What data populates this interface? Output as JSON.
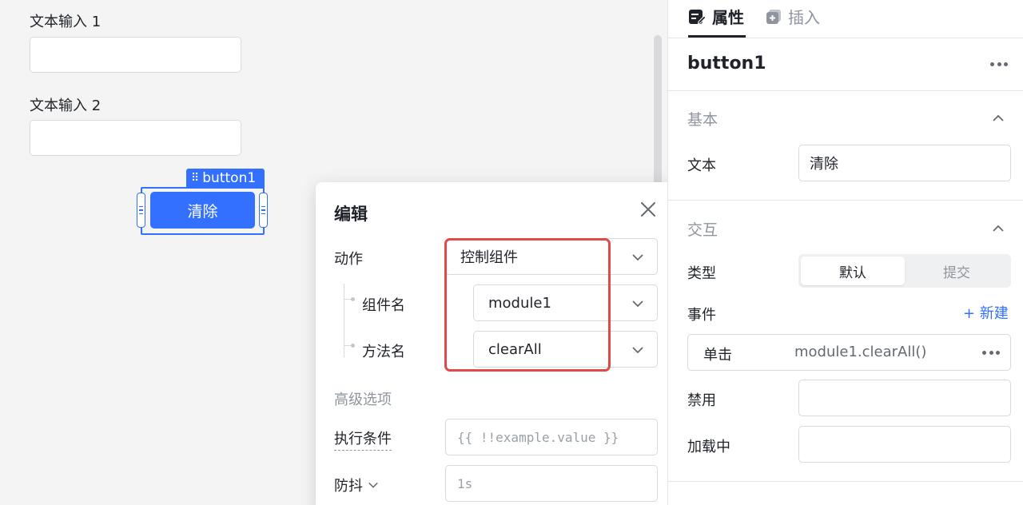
{
  "canvas": {
    "input1_label": "文本输入 1",
    "input2_label": "文本输入 2",
    "selected_tag": "button1",
    "button_label": "清除"
  },
  "dialog": {
    "title": "编辑",
    "action_label": "动作",
    "action_value": "控制组件",
    "component_label": "组件名",
    "component_value": "module1",
    "method_label": "方法名",
    "method_value": "clearAll",
    "advanced_title": "高级选项",
    "condition_label": "执行条件",
    "condition_placeholder": "{{ !!example.value }}",
    "debounce_label": "防抖",
    "debounce_placeholder": "1s",
    "highlight_color": "#e04a4a"
  },
  "panel": {
    "tab_properties": "属性",
    "tab_insert": "插入",
    "component_name": "button1",
    "basic": {
      "title": "基本",
      "text_label": "文本",
      "text_value": "清除"
    },
    "interaction": {
      "title": "交互",
      "type_label": "类型",
      "type_options": [
        "默认",
        "提交"
      ],
      "type_selected": "默认",
      "event_label": "事件",
      "add_event": "+ 新建",
      "event_name": "单击",
      "event_value": "module1.clearAll()",
      "disabled_label": "禁用",
      "loading_label": "加载中"
    }
  },
  "colors": {
    "accent": "#3370ff",
    "highlight": "#e04a4a"
  }
}
